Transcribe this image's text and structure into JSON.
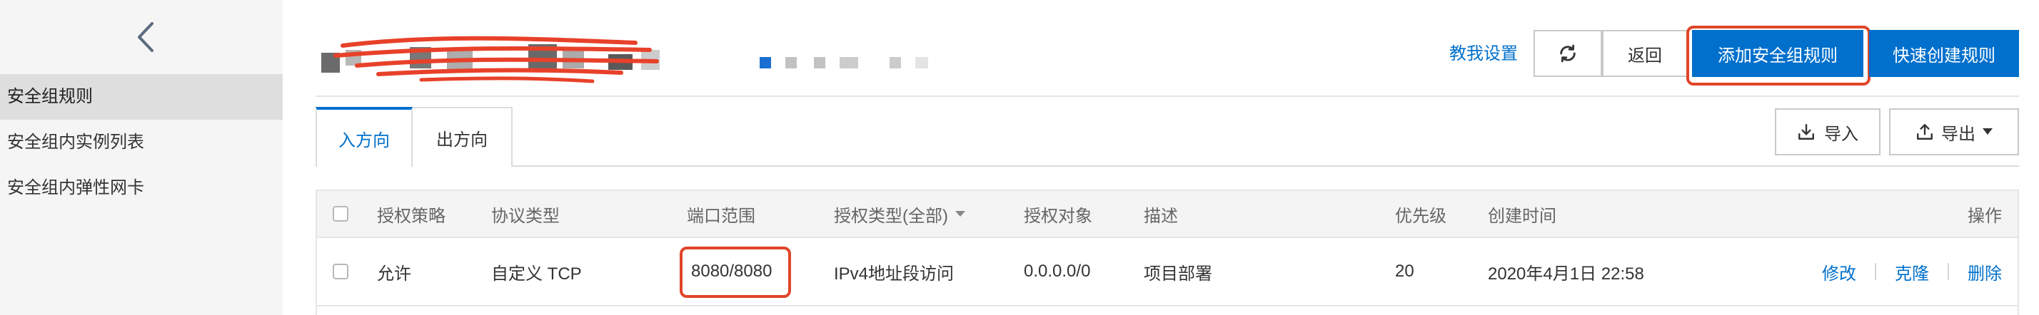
{
  "sidebar": {
    "collapse_icon": "chevron-left-icon",
    "items": [
      {
        "label": "安全组规则",
        "active": true
      },
      {
        "label": "安全组内实例列表",
        "active": false
      },
      {
        "label": "安全组内弹性网卡",
        "active": false
      }
    ]
  },
  "header": {
    "tutorial_link": "教我设置",
    "refresh_icon": "refresh-icon",
    "back_label": "返回",
    "add_rule_label": "添加安全组规则",
    "quick_create_label": "快速创建规则"
  },
  "tabs": [
    {
      "label": "入方向",
      "active": true
    },
    {
      "label": "出方向",
      "active": false
    }
  ],
  "toolbar": {
    "import_label": "导入",
    "export_label": "导出"
  },
  "table": {
    "columns": [
      "授权策略",
      "协议类型",
      "端口范围",
      "授权类型(全部)",
      "授权对象",
      "描述",
      "优先级",
      "创建时间",
      "操作"
    ],
    "rows": [
      {
        "policy": "允许",
        "protocol": "自定义 TCP",
        "port_range": "8080/8080",
        "auth_type": "IPv4地址段访问",
        "auth_object": "0.0.0.0/0",
        "description": "项目部署",
        "priority": "20",
        "created": "2020年4月1日 22:58",
        "actions": [
          "修改",
          "克隆",
          "删除"
        ]
      }
    ]
  },
  "colors": {
    "primary": "#0070cc",
    "highlight": "#e0452a",
    "brand_orange": "#ff6a00"
  }
}
